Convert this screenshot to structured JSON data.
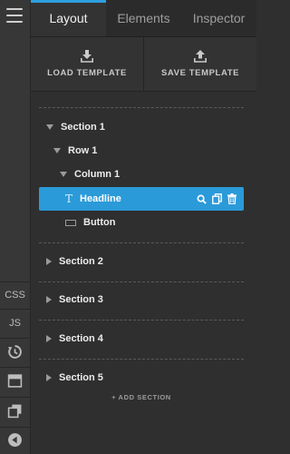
{
  "tabs": [
    {
      "label": "Layout"
    },
    {
      "label": "Elements"
    },
    {
      "label": "Inspector"
    }
  ],
  "templates": {
    "load_label": "LOAD TEMPLATE",
    "save_label": "SAVE TEMPLATE"
  },
  "rail": {
    "css_label": "CSS",
    "js_label": "JS"
  },
  "tree": {
    "section1": "Section 1",
    "row1": "Row 1",
    "column1": "Column 1",
    "headline": "Headline",
    "button": "Button",
    "section2": "Section 2",
    "section3": "Section 3",
    "section4": "Section 4",
    "section5": "Section 5",
    "add_section": "+ ADD SECTION"
  },
  "colors": {
    "accent": "#2d9fe0",
    "selected": "#2b9ad9",
    "background": "#2f2f2f"
  }
}
